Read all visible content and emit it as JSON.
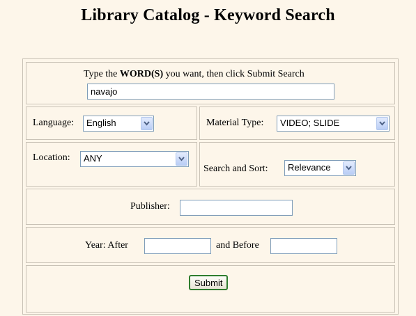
{
  "page": {
    "title": "Library Catalog - Keyword Search"
  },
  "keywords": {
    "instruction_before": "Type the ",
    "instruction_bold": "WORD(S)",
    "instruction_after": " you want, then click Submit Search",
    "value": "navajo"
  },
  "language": {
    "label": "Language:",
    "selected": "English"
  },
  "material_type": {
    "label": "Material Type:",
    "selected": "VIDEO; SLIDE"
  },
  "location": {
    "label": "Location:",
    "selected": "ANY"
  },
  "search_sort": {
    "label": "Search and Sort:",
    "selected": "Relevance"
  },
  "publisher": {
    "label": "Publisher:",
    "value": ""
  },
  "year": {
    "label": "Year: After",
    "between_label": "and Before",
    "after_value": "",
    "before_value": ""
  },
  "submit": {
    "label": "Submit"
  },
  "colors": {
    "background": "#fdf6ea",
    "border": "#c9c2b6",
    "input_border": "#7f9db9",
    "button_border": "#2f7d2f"
  },
  "icons": {
    "dropdown": "chevron-down-icon"
  }
}
